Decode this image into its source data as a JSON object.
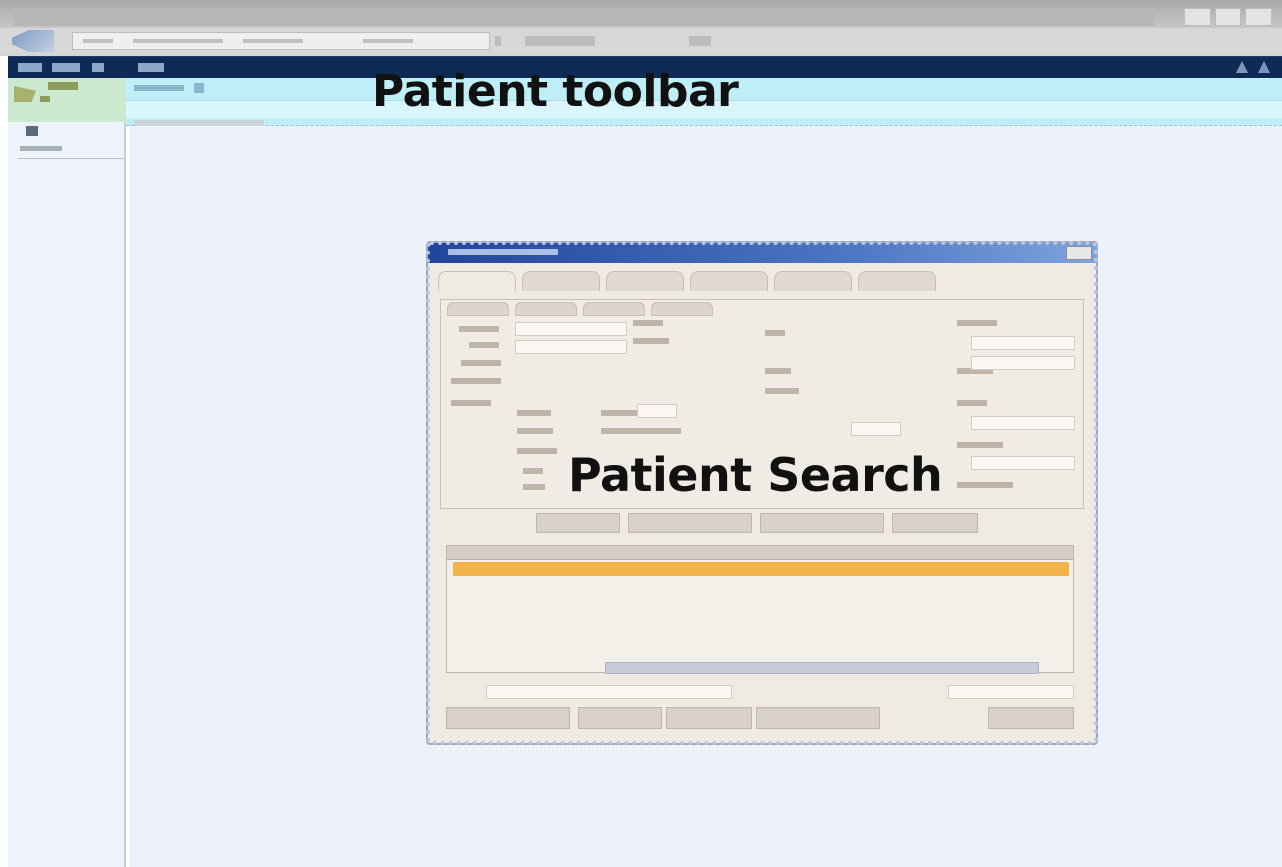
{
  "annotations": {
    "patient_toolbar_label": "Patient toolbar",
    "patient_search_label": "Patient Search"
  },
  "icons": {
    "back": "back-arrow-icon",
    "close": "close-icon",
    "header_actions": [
      "up-arrow-icon",
      "options-icon"
    ]
  },
  "colors": {
    "app_header": "#0e2b55",
    "patient_toolbar": "#bfeef7",
    "dialog_titlebar": "#21459b",
    "selected_row": "#f2b349",
    "dialog_background": "#efeae4",
    "main_background": "#edf1fa"
  }
}
